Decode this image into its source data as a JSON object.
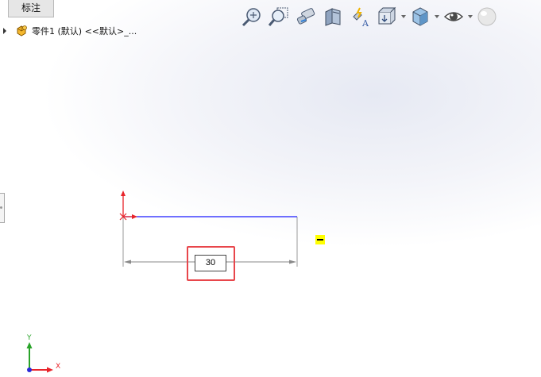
{
  "tab": {
    "label": "标注"
  },
  "feature_tree": {
    "part_label": "零件1 (默认) <<默认>_..."
  },
  "toolbar": {
    "icons": [
      "zoom-to-fit-icon",
      "zoom-area-icon",
      "previous-view-icon",
      "section-view-icon",
      "dynamic-annotation-icon",
      "view-orientation-icon",
      "display-style-icon",
      "hide-show-icon",
      "appearance-icon"
    ]
  },
  "sketch": {
    "dimension_value": "30",
    "colors": {
      "line": "#1a1aff",
      "origin": "#e8242a",
      "dimension": "#808080",
      "highlight": "#e8464b"
    }
  },
  "triad": {
    "y_label": "Y",
    "x_label": "X"
  }
}
